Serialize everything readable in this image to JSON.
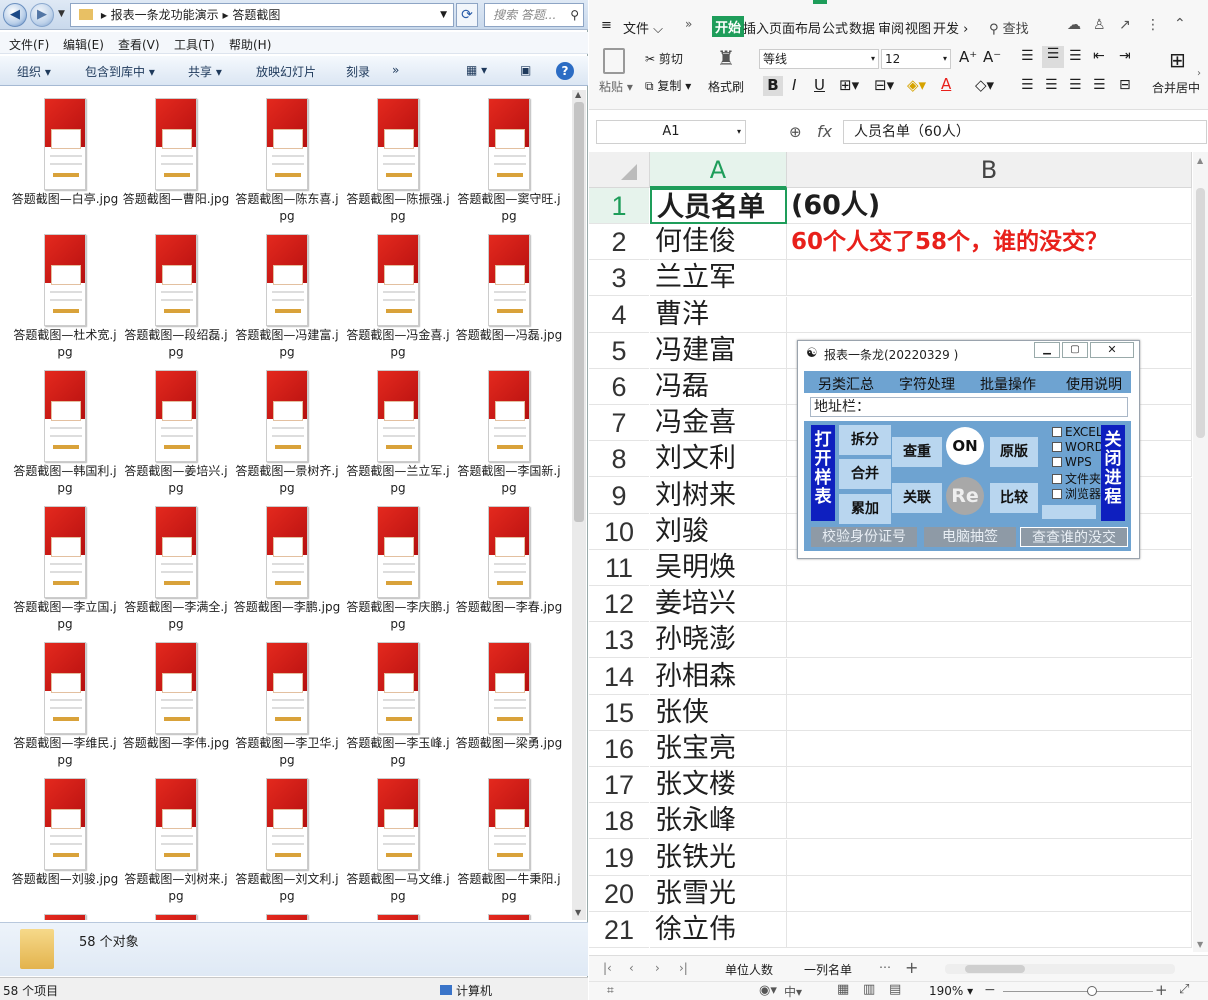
{
  "explorer": {
    "path": [
      "报表一条龙功能演示",
      "答题截图"
    ],
    "search_placeholder": "搜索 答题...",
    "menu": [
      "文件(F)",
      "编辑(E)",
      "查看(V)",
      "工具(T)",
      "帮助(H)"
    ],
    "toolbar": [
      "组织",
      "包含到库中",
      "共享",
      "放映幻灯片",
      "刻录",
      "»"
    ],
    "files": [
      "答题截图—白亭.jpg",
      "答题截图—曹阳.jpg",
      "答题截图—陈东喜.jpg",
      "答题截图—陈振强.jpg",
      "答题截图—窦守旺.jpg",
      "答题截图—杜术宽.jpg",
      "答题截图—段绍磊.jpg",
      "答题截图—冯建富.jpg",
      "答题截图—冯金喜.jpg",
      "答题截图—冯磊.jpg",
      "答题截图—韩国利.jpg",
      "答题截图—姜培兴.jpg",
      "答题截图—景树齐.jpg",
      "答题截图—兰立军.jpg",
      "答题截图—李国新.jpg",
      "答题截图—李立国.jpg",
      "答题截图—李满全.jpg",
      "答题截图—李鹏.jpg",
      "答题截图—李庆鹏.jpg",
      "答题截图—李春.jpg",
      "答题截图—李维民.jpg",
      "答题截图—李伟.jpg",
      "答题截图—李卫华.jpg",
      "答题截图—李玉峰.jpg",
      "答题截图—梁勇.jpg",
      "答题截图—刘骏.jpg",
      "答题截图—刘树来.jpg",
      "答题截图—刘文利.jpg",
      "答题截图—马文维.jpg",
      "答题截图—牛秉阳.jpg"
    ],
    "details_count": "58 个对象",
    "status_left": "58 个项目",
    "status_right": "计算机"
  },
  "wps": {
    "file_menu": "文件",
    "tabs": [
      "开始",
      "插入",
      "页面布局",
      "公式",
      "数据",
      "审阅",
      "视图",
      "开发"
    ],
    "search": "查找",
    "ribbon": {
      "paste": "粘贴",
      "cut": "剪切",
      "copy": "复制",
      "format_painter": "格式刷",
      "font_name": "等线",
      "font_size": "12",
      "merge": "合并居中"
    },
    "name_box": "A1",
    "formula": "人员名单（60人）",
    "columns": [
      "A",
      "B"
    ],
    "rows": [
      {
        "num": "1",
        "a": "人员名单"
      },
      {
        "num": "2",
        "a": "何佳俊"
      },
      {
        "num": "3",
        "a": "兰立军"
      },
      {
        "num": "4",
        "a": "曹洋"
      },
      {
        "num": "5",
        "a": "冯建富"
      },
      {
        "num": "6",
        "a": "冯磊"
      },
      {
        "num": "7",
        "a": "冯金喜"
      },
      {
        "num": "8",
        "a": "刘文利"
      },
      {
        "num": "9",
        "a": "刘树来"
      },
      {
        "num": "10",
        "a": "刘骏"
      },
      {
        "num": "11",
        "a": "吴明焕"
      },
      {
        "num": "12",
        "a": "姜培兴"
      },
      {
        "num": "13",
        "a": "孙晓澎"
      },
      {
        "num": "14",
        "a": "孙相森"
      },
      {
        "num": "15",
        "a": "张侠"
      },
      {
        "num": "16",
        "a": "张宝亮"
      },
      {
        "num": "17",
        "a": "张文楼"
      },
      {
        "num": "18",
        "a": "张永峰"
      },
      {
        "num": "19",
        "a": "张铁光"
      },
      {
        "num": "20",
        "a": "张雪光"
      },
      {
        "num": "21",
        "a": "徐立伟"
      }
    ],
    "b1": "(60人)",
    "b2": "60个人交了58个，谁的没交？",
    "sheets": [
      "单位人数",
      "一列名单"
    ],
    "zoom": "190%",
    "accent": "#1e9d5a",
    "red_text": "#e8201b"
  },
  "plugin": {
    "title": "报表一条龙(20220329 )",
    "menu": [
      "另类汇总",
      "字符处理",
      "批量操作",
      "使用说明"
    ],
    "address_label": "地址栏：",
    "open_sample": "打开样表",
    "close_process": "关闭进程",
    "buttons": {
      "split": "拆分",
      "merge": "合并",
      "accumulate": "累加",
      "dedupe": "查重",
      "link": "关联",
      "on": "ON",
      "re": "Re",
      "original": "原版",
      "compare": "比较"
    },
    "checks": [
      "EXCEL",
      "WORD",
      "WPS",
      "文件夹",
      "浏览器"
    ],
    "bottom": [
      "校验身份证号",
      "电脑抽签",
      "查查谁的没交"
    ]
  }
}
